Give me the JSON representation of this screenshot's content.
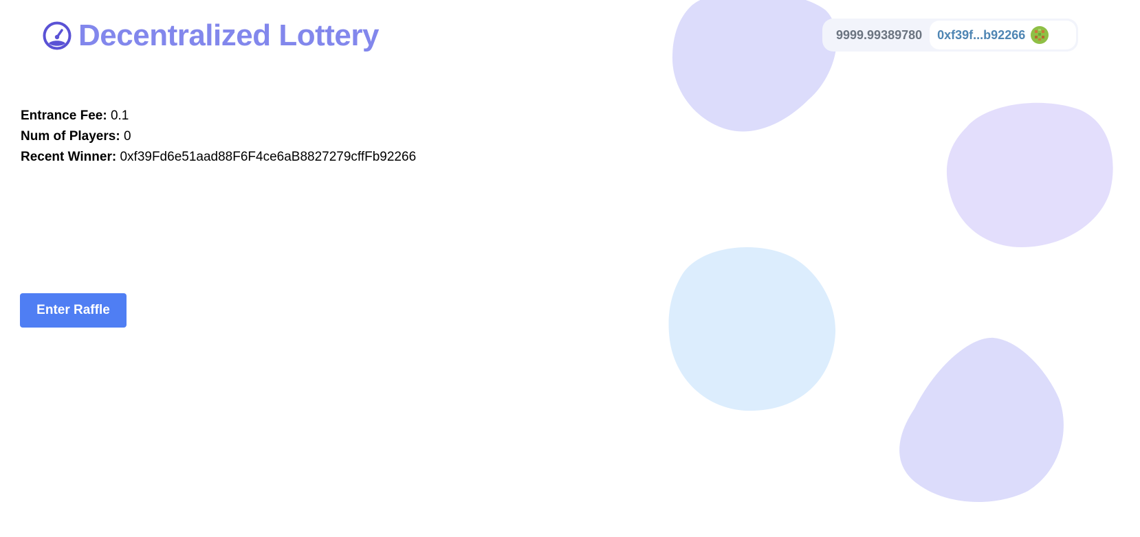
{
  "header": {
    "title": "Decentralized Lottery",
    "logo_icon": "gauge-icon"
  },
  "wallet": {
    "balance": "9999.99389780",
    "address": "0xf39f...b92266",
    "avatar_icon": "identicon-avatar"
  },
  "raffle": {
    "entrance_fee_label": "Entrance Fee:",
    "entrance_fee_value": "0.1",
    "num_players_label": "Num of Players:",
    "num_players_value": "0",
    "recent_winner_label": "Recent Winner:",
    "recent_winner_value": "0xf39Fd6e51aad88F6F4ce6aB8827279cffFb92266"
  },
  "actions": {
    "enter_label": "Enter Raffle"
  },
  "colors": {
    "title": "#8287ec",
    "logo": "#5a52d5",
    "button": "#4f7ef3",
    "blob_lavender": "#dcdcfb",
    "blob_purple": "#e3defc",
    "blob_blue": "#dcedfd"
  }
}
